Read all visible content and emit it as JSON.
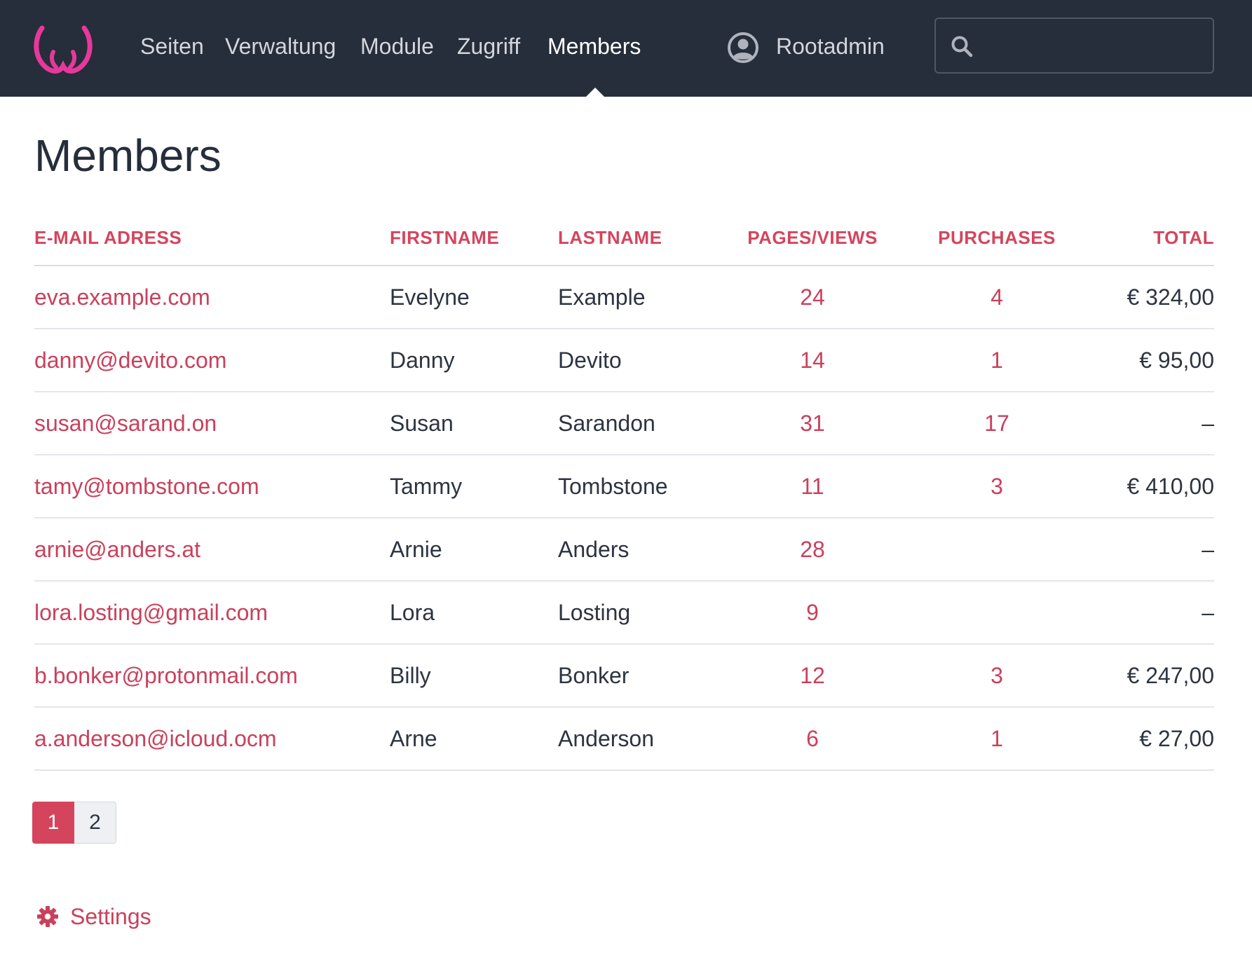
{
  "colors": {
    "navbar_bg": "#262d3b",
    "accent": "#d4455d",
    "logo": "#e8389a",
    "text": "#2d3441"
  },
  "nav": {
    "items": [
      {
        "label": "Seiten",
        "active": false
      },
      {
        "label": "Verwaltung",
        "active": false
      },
      {
        "label": "Module",
        "active": false
      },
      {
        "label": "Zugriff",
        "active": false
      },
      {
        "label": "Members",
        "active": true
      }
    ],
    "user": {
      "icon": "user-circle-icon",
      "name": "Rootadmin"
    },
    "search": {
      "icon": "search-icon",
      "placeholder": "",
      "value": ""
    }
  },
  "page": {
    "title": "Members"
  },
  "table": {
    "headers": {
      "email": "E-MAIL ADRESS",
      "firstname": "FIRSTNAME",
      "lastname": "LASTNAME",
      "pages": "PAGES/VIEWS",
      "purchases": "PURCHASES",
      "total": "TOTAL"
    },
    "rows": [
      {
        "email": "eva.example.com",
        "firstname": "Evelyne",
        "lastname": "Example",
        "pages": "24",
        "purchases": "4",
        "total": "€ 324,00"
      },
      {
        "email": "danny@devito.com",
        "firstname": "Danny",
        "lastname": "Devito",
        "pages": "14",
        "purchases": "1",
        "total": "€ 95,00"
      },
      {
        "email": "susan@sarand.on",
        "firstname": "Susan",
        "lastname": "Sarandon",
        "pages": "31",
        "purchases": "17",
        "total": "–"
      },
      {
        "email": "tamy@tombstone.com",
        "firstname": "Tammy",
        "lastname": "Tombstone",
        "pages": "11",
        "purchases": "3",
        "total": "€ 410,00"
      },
      {
        "email": "arnie@anders.at",
        "firstname": "Arnie",
        "lastname": "Anders",
        "pages": "28",
        "purchases": "",
        "total": "–"
      },
      {
        "email": "lora.losting@gmail.com",
        "firstname": "Lora",
        "lastname": "Losting",
        "pages": "9",
        "purchases": "",
        "total": "–"
      },
      {
        "email": "b.bonker@protonmail.com",
        "firstname": "Billy",
        "lastname": "Bonker",
        "pages": "12",
        "purchases": "3",
        "total": "€ 247,00"
      },
      {
        "email": "a.anderson@icloud.ocm",
        "firstname": "Arne",
        "lastname": "Anderson",
        "pages": "6",
        "purchases": "1",
        "total": "€ 27,00"
      }
    ]
  },
  "pagination": {
    "pages": [
      "1",
      "2"
    ],
    "current": "1"
  },
  "settings": {
    "icon": "gear-icon",
    "label": "Settings"
  }
}
